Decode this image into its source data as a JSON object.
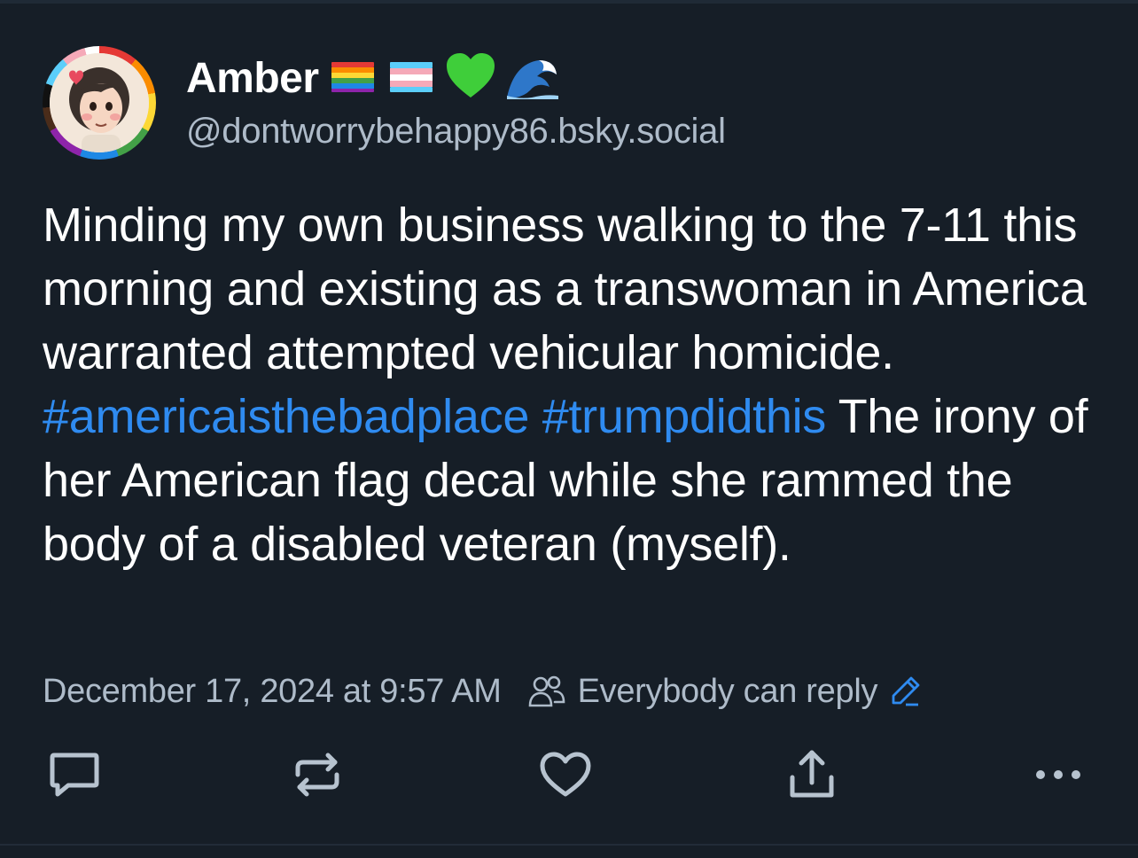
{
  "author": {
    "display_name": "Amber",
    "name_emojis": [
      "rainbow-flag",
      "transgender-flag",
      "green-heart",
      "wave"
    ],
    "handle": "@dontworrybehappy86.bsky.social"
  },
  "post": {
    "text_segments": [
      {
        "type": "text",
        "value": "Minding my own business walking to the 7-11 this morning and existing as a transwoman in America warranted attempted vehicular homicide. "
      },
      {
        "type": "hashtag",
        "value": "#americaisthebadplace"
      },
      {
        "type": "text",
        "value": " "
      },
      {
        "type": "hashtag",
        "value": "#trumpdidthis"
      },
      {
        "type": "text",
        "value": " The irony of her American flag decal while she rammed the body of a disabled veteran (myself)."
      }
    ]
  },
  "meta": {
    "timestamp": "December 17, 2024 at 9:57 AM",
    "reply_setting": "Everybody can reply"
  },
  "actions": [
    {
      "name": "reply",
      "icon": "speech-bubble-icon"
    },
    {
      "name": "repost",
      "icon": "repost-icon"
    },
    {
      "name": "like",
      "icon": "heart-icon"
    },
    {
      "name": "share",
      "icon": "share-icon"
    },
    {
      "name": "more",
      "icon": "more-icon"
    }
  ],
  "colors": {
    "background": "#161e27",
    "text": "#ffffff",
    "muted": "#aebbc9",
    "link": "#2f8bf0",
    "icon": "#b7c3cf"
  }
}
